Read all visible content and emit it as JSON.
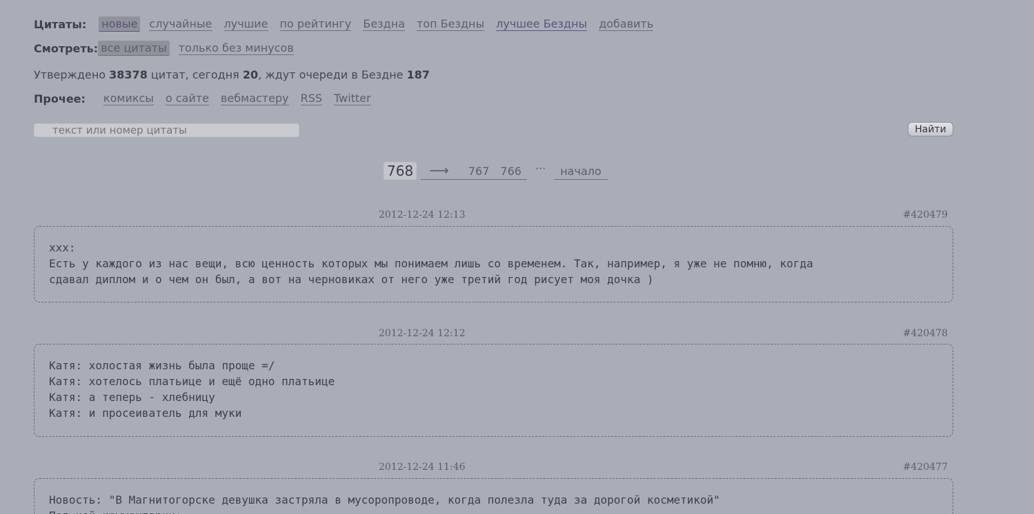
{
  "nav": {
    "quotes_label": "Цитаты:",
    "quotes_links": [
      "новые",
      "случайные",
      "лучшие",
      "по рейтингу",
      "Бездна",
      "топ Бездны",
      "лучшее Бездны",
      "добавить"
    ],
    "view_label": "Смотреть:",
    "view_links": [
      "все цитаты",
      "только без минусов"
    ],
    "other_label": "Прочее:",
    "other_links": [
      "комиксы",
      "о сайте",
      "вебмастеру",
      "RSS",
      "Twitter"
    ]
  },
  "stats": {
    "prefix": "Утверждено ",
    "approved": "38378",
    "mid1": " цитат, сегодня ",
    "today": "20",
    "mid2": ", ждут очереди в Бездне ",
    "queue": "187"
  },
  "search": {
    "placeholder": "текст или номер цитаты",
    "button": "Найти"
  },
  "pager": {
    "current": "768",
    "arrow": "⟶",
    "pages": [
      "767",
      "766"
    ],
    "dots": "···",
    "start": "начало"
  },
  "quotes": [
    {
      "date": "2012-12-24 12:13",
      "id": "#420479",
      "text": "xxx:\nЕсть у каждого из нас вещи, всю ценность которых мы понимаем лишь со временем. Так, например, я уже не помню, когда\nсдавал диплом и о чем он был, а вот на черновиках от него уже третий год рисует моя дочка )"
    },
    {
      "date": "2012-12-24 12:12",
      "id": "#420478",
      "text": "Катя: холостая жизнь была проще =/\nКатя: хотелось платьице и ещё одно платьице\nКатя: а теперь - хлебницу\nКатя: и просеиватель для муки"
    },
    {
      "date": "2012-12-24 11:46",
      "id": "#420477",
      "text": "Новость: \"В Магнитогорске девушка застряла в мусоропроводе, когда полезла туда за дорогой косметикой\"\nПод ней комментарии:"
    }
  ]
}
